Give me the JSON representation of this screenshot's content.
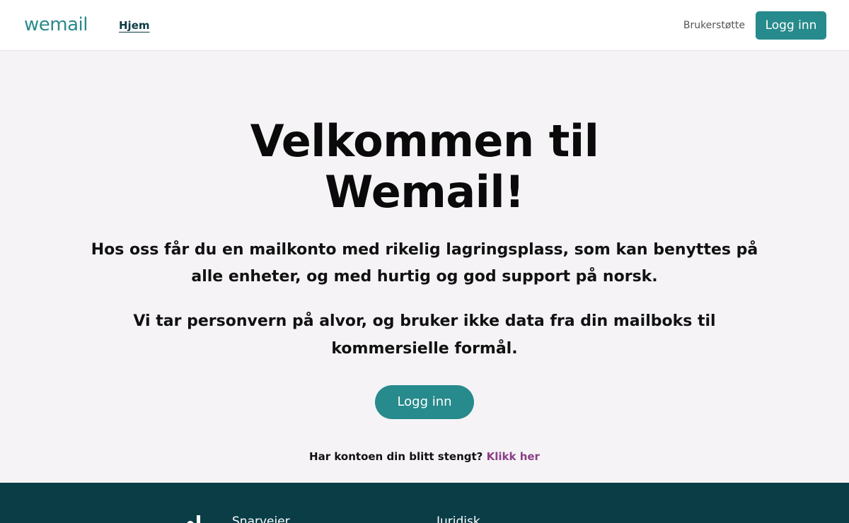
{
  "header": {
    "logo": "wemail",
    "nav_home": "Hjem",
    "nav_support": "Brukerstøtte",
    "login_label": "Logg inn"
  },
  "hero": {
    "title": "Velkommen til Wemail!",
    "text_1": "Hos oss får du en mailkonto med rikelig lagringsplass, som kan benyttes på alle enheter, og med hurtig og god support på norsk.",
    "text_2": "Vi tar personvern på alvor, og bruker ikke data fra din mailboks til kommersielle formål.",
    "login_label": "Logg inn",
    "closed_question": "Har kontoen din blitt stengt?",
    "closed_link": "Klikk her"
  },
  "footer": {
    "heading_1": "Snarveier",
    "heading_2": "Juridisk"
  },
  "colors": {
    "accent": "#278a8c",
    "footer_bg": "#0b3d47",
    "link": "#8b3f86",
    "page_bg": "#f5f3f6"
  }
}
